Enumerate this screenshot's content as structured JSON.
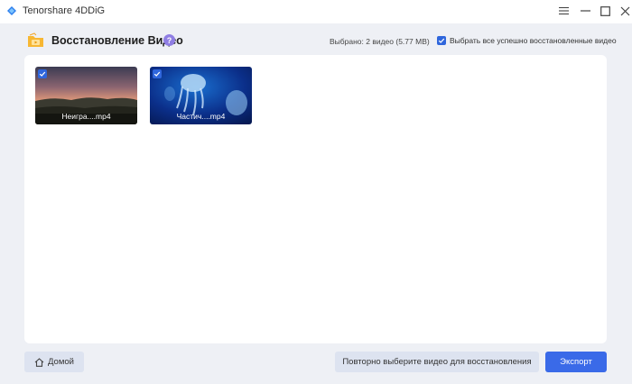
{
  "window": {
    "app_title": "Tenorshare 4DDiG",
    "buttons": [
      "menu-icon",
      "minimize-icon",
      "maximize-icon",
      "close-icon"
    ]
  },
  "header": {
    "title": "Восстановление Видео",
    "help_label": "?",
    "selected_info": "Выбрано: 2 видео (5.77 MB)",
    "select_all_label": "Выбрать все успешно восстановленные видео",
    "select_all_checked": true
  },
  "videos": [
    {
      "name": "Неигра....mp4",
      "checked": true,
      "thumbnail": "sunset-landscape"
    },
    {
      "name": "Частич....mp4",
      "checked": true,
      "thumbnail": "jellyfish"
    }
  ],
  "footer": {
    "home_label": "Домой",
    "reselect_label": "Повторно выберите видео для восстановления",
    "export_label": "Экспорт"
  },
  "colors": {
    "accent": "#3a6ae8",
    "checkbox": "#2f66dc",
    "help_badge": "#8f7ee3",
    "background": "#eef0f5"
  }
}
